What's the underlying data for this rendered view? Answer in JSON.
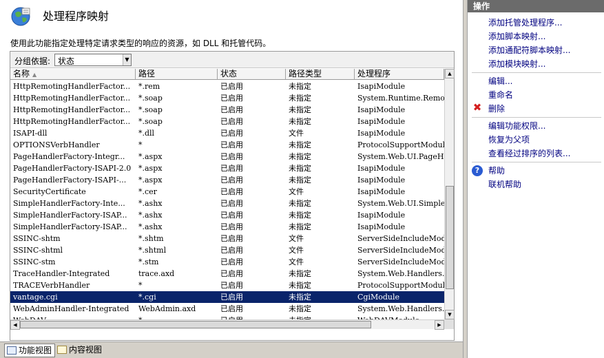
{
  "header": {
    "title": "处理程序映射",
    "description": "使用此功能指定处理特定请求类型的响应的资源，如 DLL 和托管代码。"
  },
  "group_by": {
    "label": "分组依据:",
    "value": "状态"
  },
  "columns": [
    "名称",
    "路径",
    "状态",
    "路径类型",
    "处理程序"
  ],
  "rows": [
    [
      "HttpRemotingHandlerFactor...",
      "*.rem",
      "已启用",
      "未指定",
      "IsapiModule"
    ],
    [
      "HttpRemotingHandlerFactor...",
      "*.soap",
      "已启用",
      "未指定",
      "System.Runtime.Remoti"
    ],
    [
      "HttpRemotingHandlerFactor...",
      "*.soap",
      "已启用",
      "未指定",
      "IsapiModule"
    ],
    [
      "HttpRemotingHandlerFactor...",
      "*.soap",
      "已启用",
      "未指定",
      "IsapiModule"
    ],
    [
      "ISAPI-dll",
      "*.dll",
      "已启用",
      "文件",
      "IsapiModule"
    ],
    [
      "OPTIONSVerbHandler",
      "*",
      "已启用",
      "未指定",
      "ProtocolSupportModule"
    ],
    [
      "PageHandlerFactory-Integr...",
      "*.aspx",
      "已启用",
      "未指定",
      "System.Web.UI.PageHar"
    ],
    [
      "PageHandlerFactory-ISAPI-2.0",
      "*.aspx",
      "已启用",
      "未指定",
      "IsapiModule"
    ],
    [
      "PageHandlerFactory-ISAPI-...",
      "*.aspx",
      "已启用",
      "未指定",
      "IsapiModule"
    ],
    [
      "SecurityCertificate",
      "*.cer",
      "已启用",
      "文件",
      "IsapiModule"
    ],
    [
      "SimpleHandlerFactory-Inte...",
      "*.ashx",
      "已启用",
      "未指定",
      "System.Web.UI.SimpleH"
    ],
    [
      "SimpleHandlerFactory-ISAP...",
      "*.ashx",
      "已启用",
      "未指定",
      "IsapiModule"
    ],
    [
      "SimpleHandlerFactory-ISAP...",
      "*.ashx",
      "已启用",
      "未指定",
      "IsapiModule"
    ],
    [
      "SSINC-shtm",
      "*.shtm",
      "已启用",
      "文件",
      "ServerSideIncludeModu"
    ],
    [
      "SSINC-shtml",
      "*.shtml",
      "已启用",
      "文件",
      "ServerSideIncludeModu"
    ],
    [
      "SSINC-stm",
      "*.stm",
      "已启用",
      "文件",
      "ServerSideIncludeModu"
    ],
    [
      "TraceHandler-Integrated",
      "trace.axd",
      "已启用",
      "未指定",
      "System.Web.Handlers.T"
    ],
    [
      "TRACEVerbHandler",
      "*",
      "已启用",
      "未指定",
      "ProtocolSupportModule"
    ],
    [
      "vantage.cgi",
      "*.cgi",
      "已启用",
      "未指定",
      "CgiModule"
    ],
    [
      "WebAdminHandler-Integrated",
      "WebAdmin.axd",
      "已启用",
      "未指定",
      "System.Web.Handlers.W"
    ],
    [
      "WebDAV",
      "*",
      "已启用",
      "未指定",
      "WebDAVModule"
    ]
  ],
  "selected_row": "vantage.cgi",
  "view_tabs": {
    "features": "功能视图",
    "content": "内容视图"
  },
  "actions": {
    "header": "操作",
    "items": [
      "添加托管处理程序...",
      "添加脚本映射...",
      "添加通配符脚本映射...",
      "添加模块映射...",
      "编辑...",
      "重命名",
      "删除",
      "编辑功能权限...",
      "恢复为父项",
      "查看经过排序的列表...",
      "帮助",
      "联机帮助"
    ]
  }
}
